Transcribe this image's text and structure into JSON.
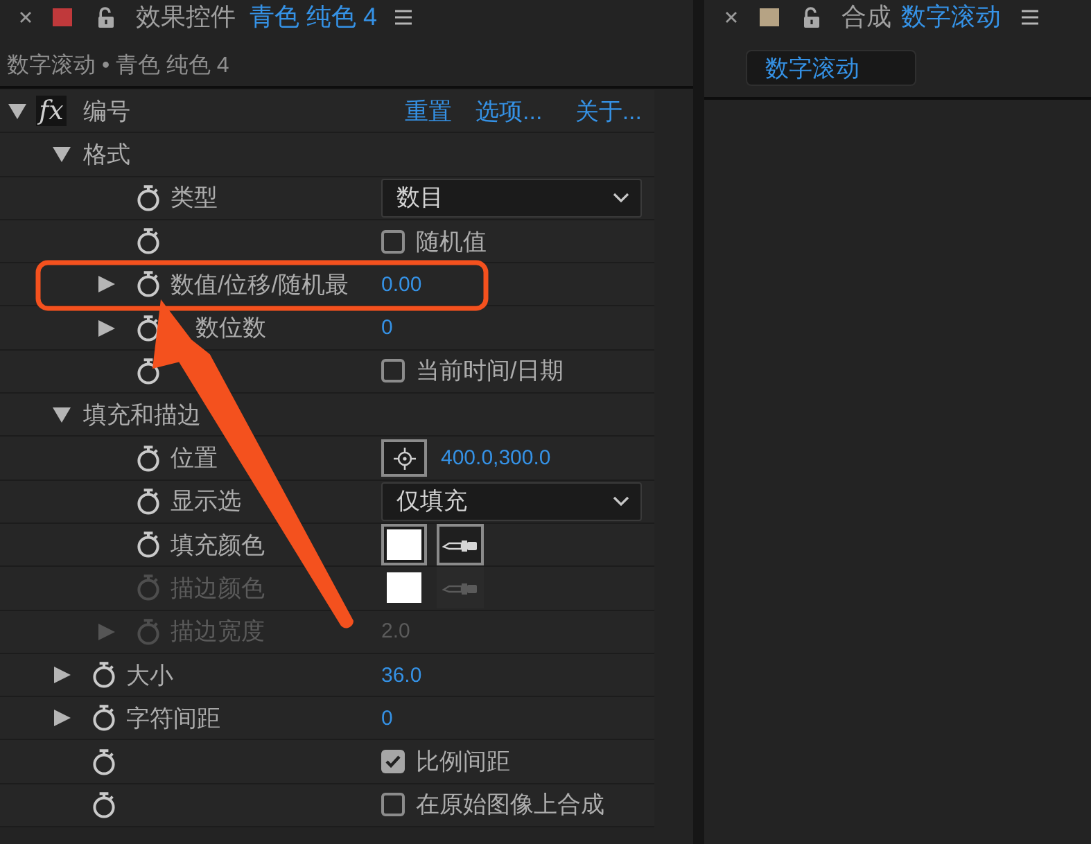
{
  "effect_controls": {
    "tab": {
      "title": "效果控件",
      "subject": "青色 纯色 4",
      "color": "#c0393b"
    },
    "breadcrumb": "数字滚动 • 青色 纯色 4",
    "effect": {
      "toggle": "fx",
      "name": "编号",
      "expanded": true,
      "actions": [
        "重置",
        "选项...",
        "关于..."
      ],
      "properties": [
        {
          "kind": "group",
          "label": "格式",
          "expanded": true,
          "children": [
            {
              "kind": "dropdown",
              "label": "类型",
              "value": "数目",
              "disabled": false
            },
            {
              "kind": "checkbox",
              "label": "随机值",
              "checked": false,
              "disabled": false
            },
            {
              "kind": "number",
              "label": "数值/位移/随机最",
              "value": "0.00",
              "expanded": false,
              "disabled": false
            },
            {
              "kind": "number",
              "label": "数位数",
              "partly_covered": true,
              "value": "0",
              "expanded": false,
              "disabled": false
            },
            {
              "kind": "checkbox",
              "label": "当前时间/日期",
              "checked": false,
              "disabled": false
            }
          ]
        },
        {
          "kind": "group",
          "label": "填充和描边",
          "expanded": true,
          "children": [
            {
              "kind": "point",
              "label": "位置",
              "value": "400.0,300.0",
              "disabled": false
            },
            {
              "kind": "dropdown",
              "label": "显示选",
              "value": "仅填充",
              "disabled": false
            },
            {
              "kind": "color",
              "label": "填充颜色",
              "color": "#ffffff",
              "disabled": false
            },
            {
              "kind": "color",
              "label": "描边颜色",
              "color": "#ffffff",
              "disabled": true
            },
            {
              "kind": "number",
              "label": "描边宽度",
              "value": "2.0",
              "expanded": false,
              "disabled": true
            }
          ]
        },
        {
          "kind": "number",
          "label": "大小",
          "value": "36.0",
          "expanded": false,
          "disabled": false
        },
        {
          "kind": "number",
          "label": "字符间距",
          "value": "0",
          "expanded": false,
          "disabled": false
        },
        {
          "kind": "checkbox",
          "label": "比例间距",
          "checked": true,
          "disabled": false
        },
        {
          "kind": "checkbox",
          "label": "在原始图像上合成",
          "checked": false,
          "disabled": false
        }
      ]
    }
  },
  "composition": {
    "tab": {
      "title": "合成",
      "subject": "数字滚动",
      "color": "#b6a384"
    },
    "viewer_tabs": [
      {
        "label": "数字滚动",
        "selected": true
      }
    ]
  }
}
